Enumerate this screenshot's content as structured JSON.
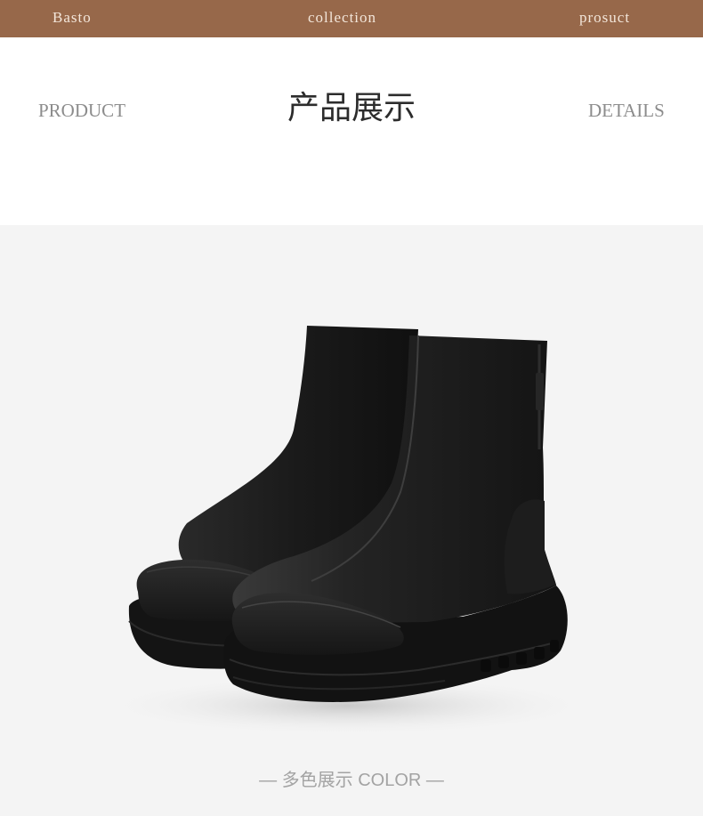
{
  "topbar": {
    "left": "Basto",
    "center": "collection",
    "right": "prosuct"
  },
  "heading": {
    "left": "PRODUCT",
    "title": "产品展示",
    "right": "DETAILS"
  },
  "footer": {
    "color_label": "— 多色展示 COLOR —"
  },
  "colors": {
    "topbar_bg": "#97684a",
    "boot": "#1b1b1b",
    "background": "#f4f4f4"
  }
}
